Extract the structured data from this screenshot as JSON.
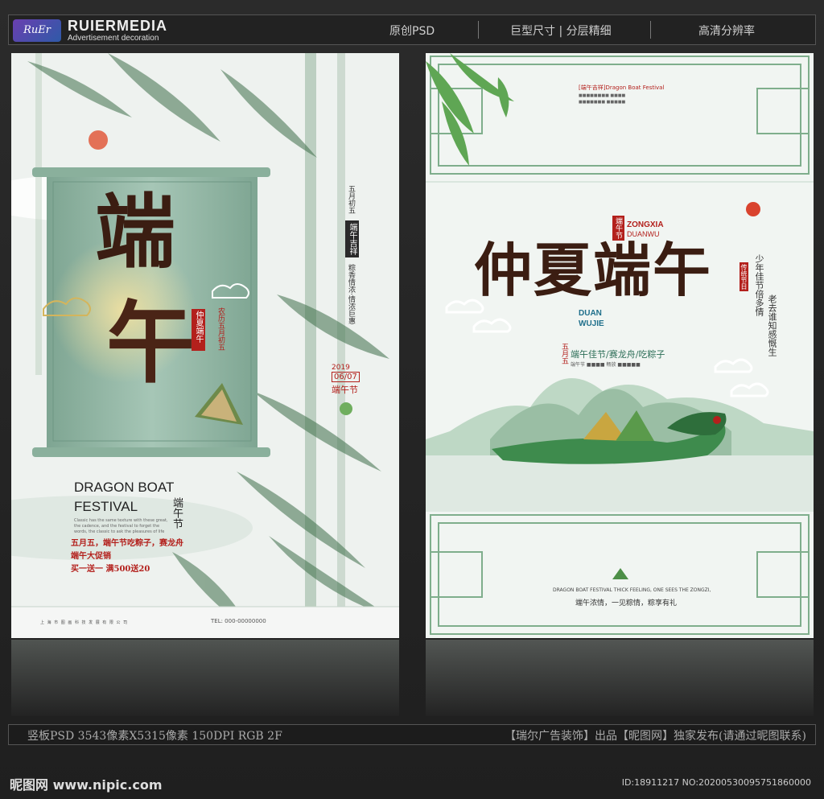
{
  "header": {
    "logo": "RuEr",
    "brand": "RUIERMEDIA",
    "brand_sub": "Advertisement decoration",
    "items": [
      "原创PSD",
      "巨型尺寸 | 分层精细",
      "高清分辨率"
    ]
  },
  "left_poster": {
    "title_char1": "端",
    "title_char2": "午",
    "seal": "仲夏端午",
    "side_text": "农历五月初五",
    "vertical1": "五月初五",
    "tag": "端午吉祥",
    "vertical2": "粽香情浓·情浓巨惠",
    "year": "2019",
    "date": "06/07",
    "small_title": "端午节",
    "en_title": "DRAGON BOAT\nFESTIVAL",
    "en_body": "Classic has the same texture with these great, the cadence, and the festival to forget the words, the classic to ask the pleasures of life",
    "vertical3": "端午节",
    "promo1": "五月五，端午节吃粽子，赛龙舟",
    "promo2": "端午大促销",
    "promo3": "买一送一  满500送20",
    "footer_company": "上 海 市 图 画 科 技 发 展 有 限 公 司",
    "footer_phone": "TEL: 000-00000000"
  },
  "right_poster": {
    "top_tag": "[端午吉祥]Dragon Boat Festival",
    "top_line1": "■■■■■■■■ ■■■■",
    "top_line2": "■■■■■■■ ■■■■■",
    "badge": "端午节",
    "zongxia": "ZONGXIA",
    "duanwu_en": "DUANWU",
    "title": "仲夏端午",
    "duan": "DUAN",
    "wujie": "WUJIE",
    "wuyue": "五月五",
    "slogan": "端午佳节/赛龙舟/吃粽子",
    "slogan_sub": "端午节 ■■■■ 畅放 ■■■■■",
    "v_tag": "传统节日",
    "v1": "少年佳节倍多情",
    "v2": "老去谁知感慨生",
    "bottom_en": "DRAGON BOAT FESTIVAL THICK FEELING, ONE SEES THE ZONGZI,",
    "bottom_cn": "端午浓情，一见粽情，粽享有礼"
  },
  "footer": {
    "left": "竖板PSD 3543像素X5315像素 150DPI RGB 2F",
    "right": "【瑞尔广告装饰】出品【昵图网】独家发布(请通过昵图联系)",
    "nipic": "昵图网 www.nipic.com",
    "id": "ID:18911217 NO:20200530095751860000"
  },
  "colors": {
    "accent_red": "#b3201c",
    "jade": "#8fb5a2",
    "ink": "#3b1d12",
    "bamboo": "#4f8f5a"
  }
}
